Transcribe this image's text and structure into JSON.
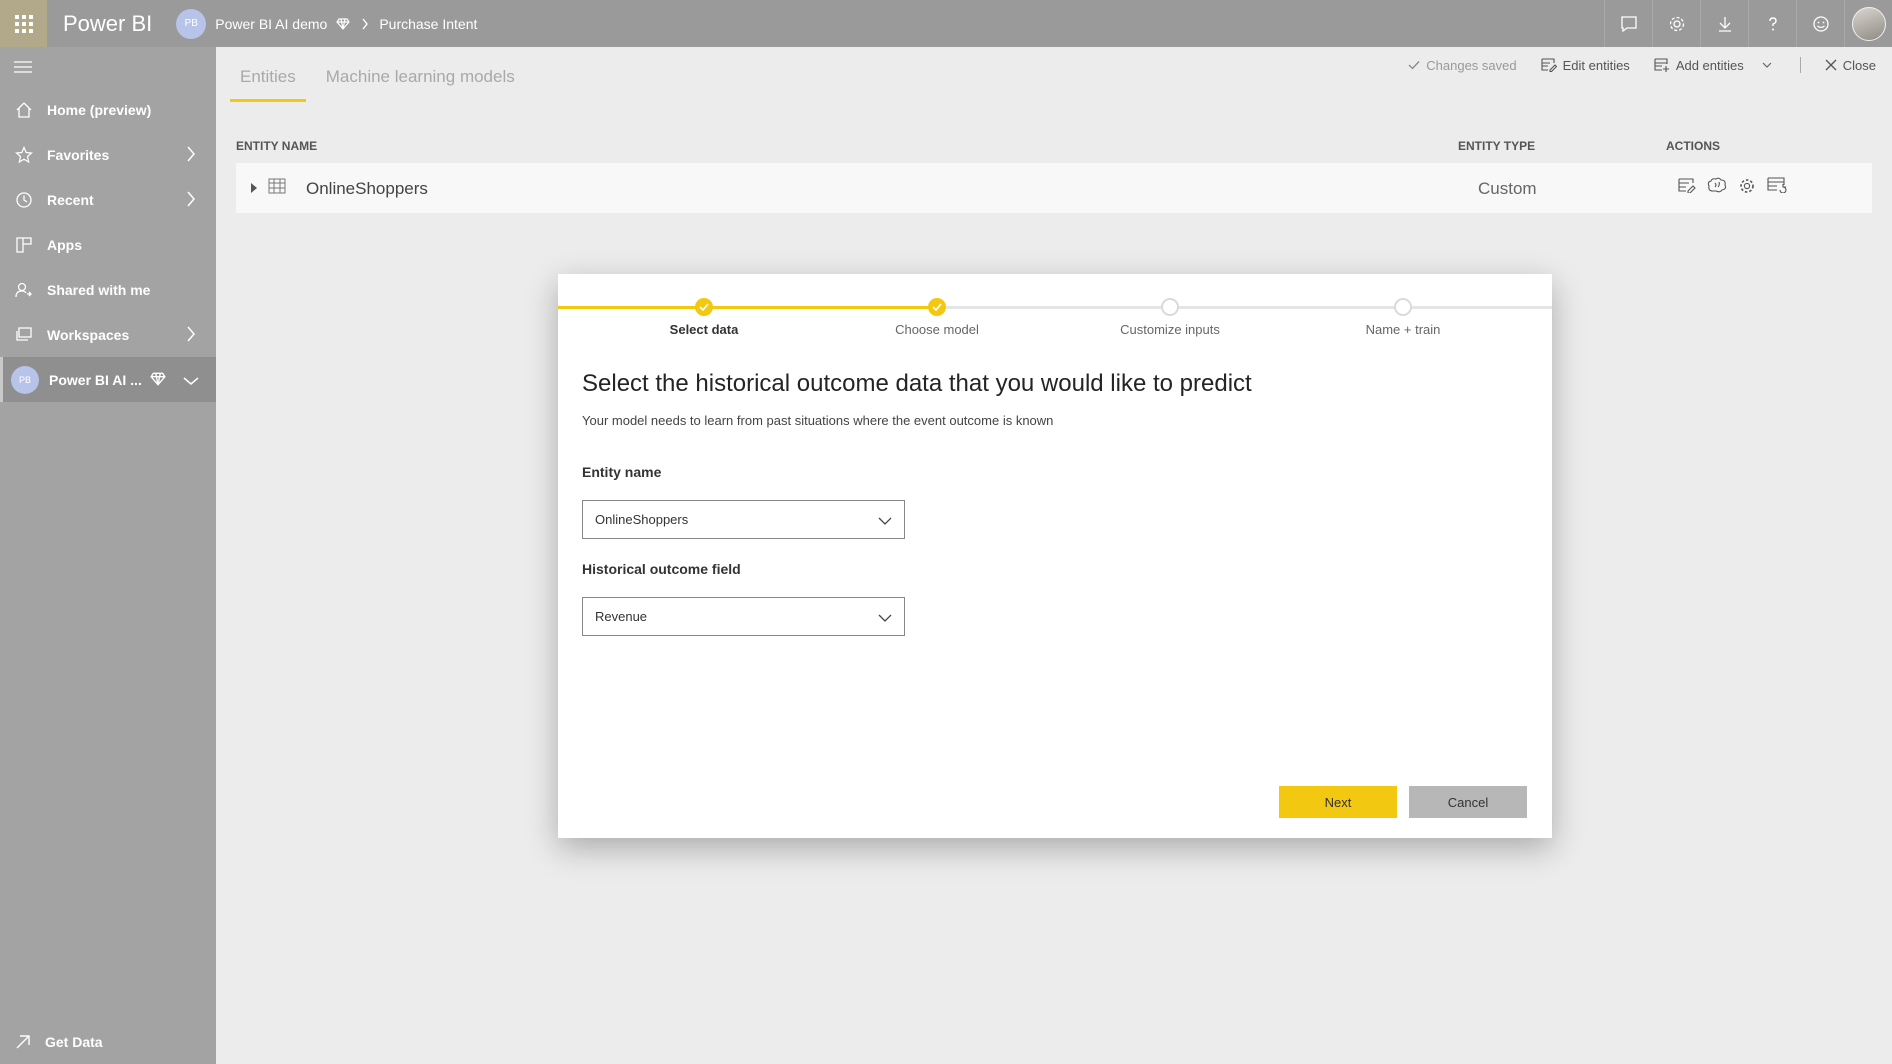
{
  "topbar": {
    "brand": "Power BI",
    "workspace_initials": "PB",
    "workspace_name": "Power BI AI demo",
    "current_item": "Purchase Intent",
    "icons": [
      "chat-icon",
      "gear-icon",
      "download-icon",
      "help-icon",
      "smiley-icon"
    ]
  },
  "sidebar": {
    "items": [
      {
        "label": "Home (preview)",
        "icon": "home-icon"
      },
      {
        "label": "Favorites",
        "icon": "star-icon"
      },
      {
        "label": "Recent",
        "icon": "clock-icon"
      },
      {
        "label": "Apps",
        "icon": "apps-icon"
      },
      {
        "label": "Shared with me",
        "icon": "shared-icon"
      },
      {
        "label": "Workspaces",
        "icon": "workspaces-icon"
      },
      {
        "label": "Power BI AI ...",
        "icon": "workspace-avatar",
        "initials": "PB"
      }
    ],
    "get_data": "Get Data"
  },
  "main": {
    "tabs": [
      {
        "label": "Entities",
        "active": true
      },
      {
        "label": "Machine learning models",
        "active": false
      }
    ],
    "actions": {
      "saved": "Changes saved",
      "edit": "Edit entities",
      "add": "Add entities",
      "close": "Close"
    },
    "table": {
      "headers": [
        "ENTITY NAME",
        "ENTITY TYPE",
        "ACTIONS"
      ],
      "rows": [
        {
          "name": "OnlineShoppers",
          "type": "Custom"
        }
      ]
    }
  },
  "modal": {
    "steps": [
      {
        "label": "Select data",
        "status": "done",
        "current": true
      },
      {
        "label": "Choose model",
        "status": "done",
        "current": false
      },
      {
        "label": "Customize inputs",
        "status": "todo",
        "current": false
      },
      {
        "label": "Name + train",
        "status": "todo",
        "current": false
      }
    ],
    "title": "Select the historical outcome data that you would like to predict",
    "subtitle": "Your model needs to learn from past situations where the event outcome is known",
    "entity_label": "Entity name",
    "entity_value": "OnlineShoppers",
    "outcome_label": "Historical outcome field",
    "outcome_value": "Revenue",
    "next": "Next",
    "cancel": "Cancel"
  },
  "colors": {
    "accent": "#f2c811",
    "topbar": "#9a9a9a",
    "sidebar": "#a3a3a3"
  }
}
